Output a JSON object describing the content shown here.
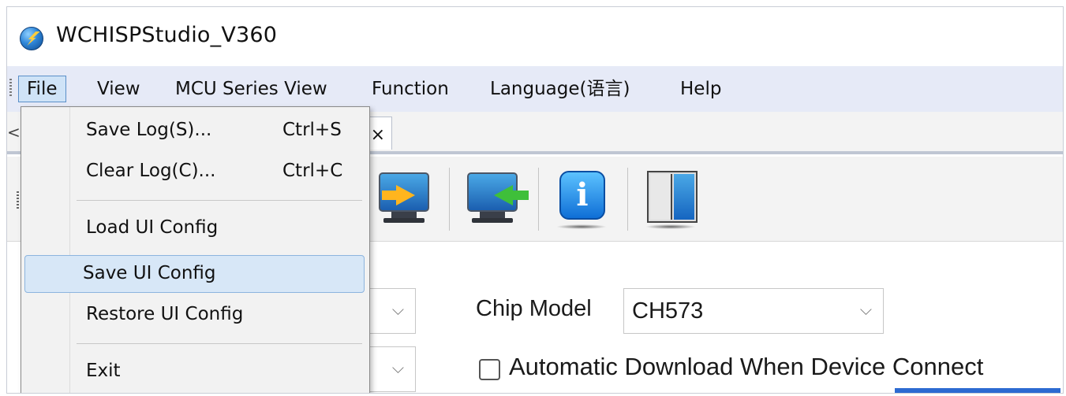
{
  "window": {
    "title": "WCHISPStudio_V360"
  },
  "menubar": {
    "items": [
      {
        "label": "File"
      },
      {
        "label": "View"
      },
      {
        "label": "MCU Series View"
      },
      {
        "label": "Function"
      },
      {
        "label": "Language(语言)"
      },
      {
        "label": "Help"
      }
    ]
  },
  "tabstrip": {
    "left_arrow": "<",
    "close_glyph": "×"
  },
  "toolbar": {
    "buttons": [
      {
        "icon": "download-to-device-icon"
      },
      {
        "icon": "upload-from-device-icon"
      },
      {
        "icon": "info-icon",
        "glyph": "i"
      },
      {
        "icon": "manual-book-icon"
      }
    ]
  },
  "file_menu": {
    "items": [
      {
        "label": "Save Log(S)...",
        "shortcut": "Ctrl+S"
      },
      {
        "label": "Clear Log(C)...",
        "shortcut": "Ctrl+C"
      },
      {
        "label": "Load UI Config"
      },
      {
        "label": "Save UI Config",
        "state": "highlighted"
      },
      {
        "label": "Restore UI Config"
      },
      {
        "label": "Exit"
      }
    ]
  },
  "main": {
    "chip_model_label": "Chip Model",
    "chip_model_value": "CH573",
    "auto_download_label": "Automatic Download When Device Connect",
    "auto_download_checked": false,
    "dropdown_caret": "⌵"
  },
  "colors": {
    "menubar_bg": "#e6eaf7",
    "menu_highlight": "#d7e7f7",
    "accent_blue": "#2c6ad1"
  }
}
